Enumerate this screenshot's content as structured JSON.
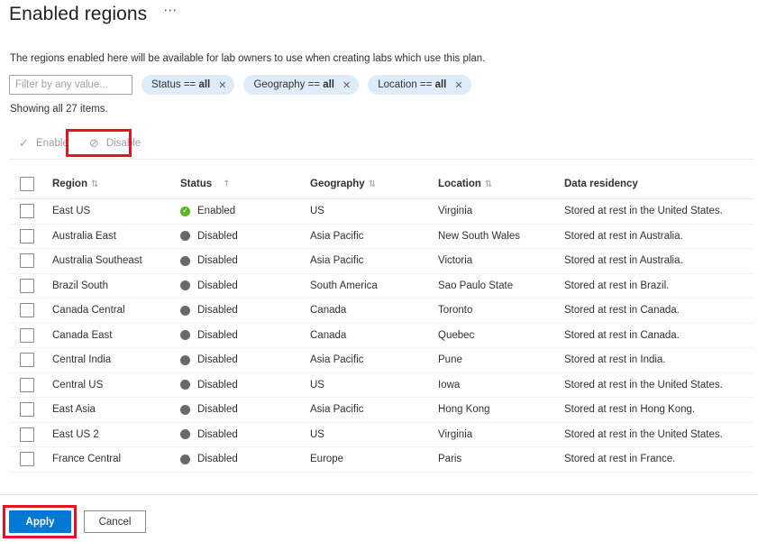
{
  "header": {
    "title": "Enabled regions",
    "more_menu": "⋯"
  },
  "description": "The regions enabled here will be available for lab owners to use when creating labs which use this plan.",
  "filter": {
    "placeholder": "Filter by any value...",
    "value": "",
    "pills": [
      {
        "field": "Status",
        "op": "==",
        "value": "all",
        "close": "✕"
      },
      {
        "field": "Geography",
        "op": "==",
        "value": "all",
        "close": "✕"
      },
      {
        "field": "Location",
        "op": "==",
        "value": "all",
        "close": "✕"
      }
    ]
  },
  "showing": "Showing all 27 items.",
  "commandbar": {
    "enable_label": "Enable",
    "enable_icon": "✓",
    "disable_label": "Disable",
    "disable_icon": "⊘"
  },
  "table": {
    "columns": [
      {
        "label": "Region",
        "sort": "⇅"
      },
      {
        "label": "Status",
        "sort": "↑"
      },
      {
        "label": "Geography",
        "sort": "⇅"
      },
      {
        "label": "Location",
        "sort": "⇅"
      },
      {
        "label": "Data residency",
        "sort": ""
      }
    ],
    "rows": [
      {
        "region": "East US",
        "status": "Enabled",
        "state": "enabled",
        "geography": "US",
        "location": "Virginia",
        "residency": "Stored at rest in the United States."
      },
      {
        "region": "Australia East",
        "status": "Disabled",
        "state": "disabled",
        "geography": "Asia Pacific",
        "location": "New South Wales",
        "residency": "Stored at rest in Australia."
      },
      {
        "region": "Australia Southeast",
        "status": "Disabled",
        "state": "disabled",
        "geography": "Asia Pacific",
        "location": "Victoria",
        "residency": "Stored at rest in Australia."
      },
      {
        "region": "Brazil South",
        "status": "Disabled",
        "state": "disabled",
        "geography": "South America",
        "location": "Sao Paulo State",
        "residency": "Stored at rest in Brazil."
      },
      {
        "region": "Canada Central",
        "status": "Disabled",
        "state": "disabled",
        "geography": "Canada",
        "location": "Toronto",
        "residency": "Stored at rest in Canada."
      },
      {
        "region": "Canada East",
        "status": "Disabled",
        "state": "disabled",
        "geography": "Canada",
        "location": "Quebec",
        "residency": "Stored at rest in Canada."
      },
      {
        "region": "Central India",
        "status": "Disabled",
        "state": "disabled",
        "geography": "Asia Pacific",
        "location": "Pune",
        "residency": "Stored at rest in India."
      },
      {
        "region": "Central US",
        "status": "Disabled",
        "state": "disabled",
        "geography": "US",
        "location": "Iowa",
        "residency": "Stored at rest in the United States."
      },
      {
        "region": "East Asia",
        "status": "Disabled",
        "state": "disabled",
        "geography": "Asia Pacific",
        "location": "Hong Kong",
        "residency": "Stored at rest in Hong Kong."
      },
      {
        "region": "East US 2",
        "status": "Disabled",
        "state": "disabled",
        "geography": "US",
        "location": "Virginia",
        "residency": "Stored at rest in the United States."
      },
      {
        "region": "France Central",
        "status": "Disabled",
        "state": "disabled",
        "geography": "Europe",
        "location": "Paris",
        "residency": "Stored at rest in France."
      }
    ]
  },
  "footer": {
    "apply_label": "Apply",
    "cancel_label": "Cancel"
  },
  "colors": {
    "accent": "#0078d4",
    "enabled": "#5bb526",
    "disabled": "#696969",
    "pill_bg": "#deecf9",
    "annotation": "#e81123"
  }
}
